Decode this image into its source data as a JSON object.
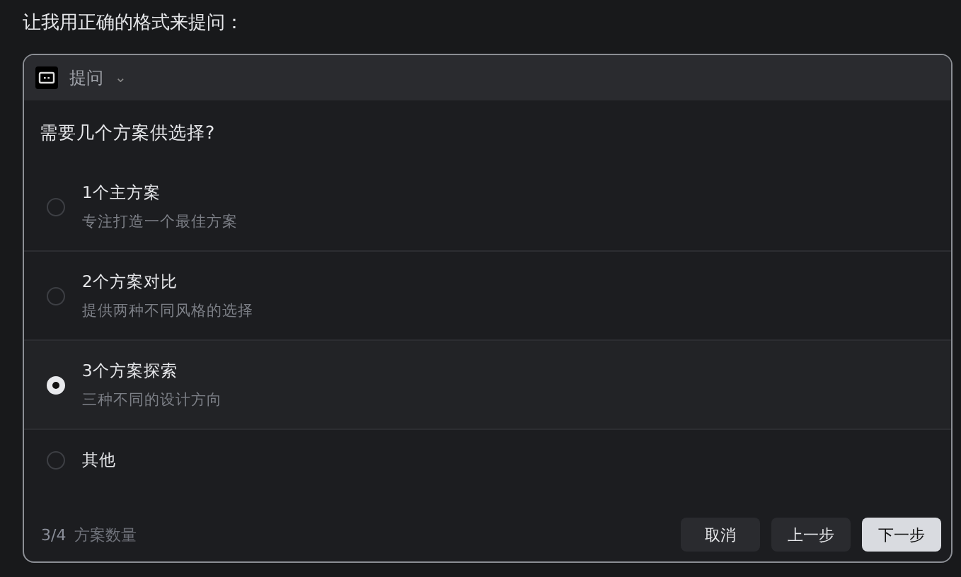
{
  "intro": "让我用正确的格式来提问：",
  "card": {
    "title": "提问",
    "toggle": "⌄",
    "question": "需要几个方案供选择?",
    "options": [
      {
        "label": "1个主方案",
        "description": "专注打造一个最佳方案",
        "selected": false
      },
      {
        "label": "2个方案对比",
        "description": "提供两种不同风格的选择",
        "selected": false
      },
      {
        "label": "3个方案探索",
        "description": "三种不同的设计方向",
        "selected": true
      },
      {
        "label": "其他",
        "selected": false
      }
    ],
    "step": "3/4",
    "step_label": "方案数量",
    "buttons": [
      {
        "label": "取消",
        "kind": "secondary"
      },
      {
        "label": "上一步",
        "kind": "secondary"
      },
      {
        "label": "下一步",
        "kind": "primary"
      }
    ]
  }
}
